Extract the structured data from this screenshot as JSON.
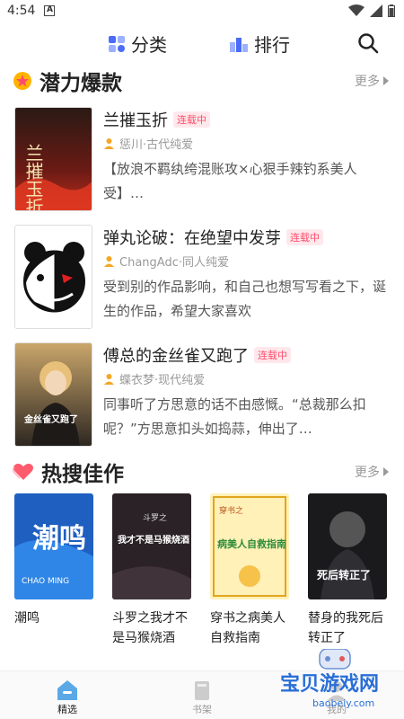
{
  "status": {
    "time": "4:54",
    "notif_letter": "A"
  },
  "nav": {
    "category_label": "分类",
    "rank_label": "排行"
  },
  "potential": {
    "title": "潜力爆款",
    "more_label": "更多",
    "books": [
      {
        "title": "兰摧玉折",
        "badge": "连载中",
        "author_genre": "惩川·古代纯爱",
        "desc": "【放浪不羁纨绔混账攻×心狠手辣钓系美人受】…",
        "cover_text": "兰摧玉折"
      },
      {
        "title": "弹丸论破：在绝望中发芽",
        "badge": "连载中",
        "author_genre": "ChangAdc·同人纯爱",
        "desc": "受到别的作品影响，和自己也想写写看之下，诞生的作品，希望大家喜欢",
        "cover_text": ""
      },
      {
        "title": "傅总的金丝雀又跑了",
        "badge": "连载中",
        "author_genre": "蝶衣梦·现代纯爱",
        "desc": "同事听了方思意的话不由感慨。“总裁那么扣呢？”方思意扣头如捣蒜，伸出了…",
        "cover_text": "金丝雀又跑了"
      }
    ]
  },
  "hot": {
    "title": "热搜佳作",
    "more_label": "更多",
    "books": [
      {
        "title": "潮鸣",
        "cover_text": "潮鸣",
        "cover_sub": "CHAO MING"
      },
      {
        "title": "斗罗之我才不是马猴烧酒",
        "cover_text": "我才不是马猴烧酒",
        "cover_sub": "斗罗之"
      },
      {
        "title": "穿书之病美人自救指南",
        "cover_text": "病美人自救指南",
        "cover_sub": "穿书之"
      },
      {
        "title": "替身的我死后转正了",
        "cover_text": "死后转正了",
        "cover_sub": ""
      }
    ]
  },
  "tabs": [
    {
      "label": "精选"
    },
    {
      "label": "书架"
    },
    {
      "label": "我的"
    }
  ],
  "watermark": {
    "text": "宝贝游戏网",
    "url": "baobeiy.com"
  },
  "colors": {
    "accent": "#ff4d6a",
    "nav_blue": "#4a6cf7",
    "tab_active": "#5aa9e6"
  }
}
